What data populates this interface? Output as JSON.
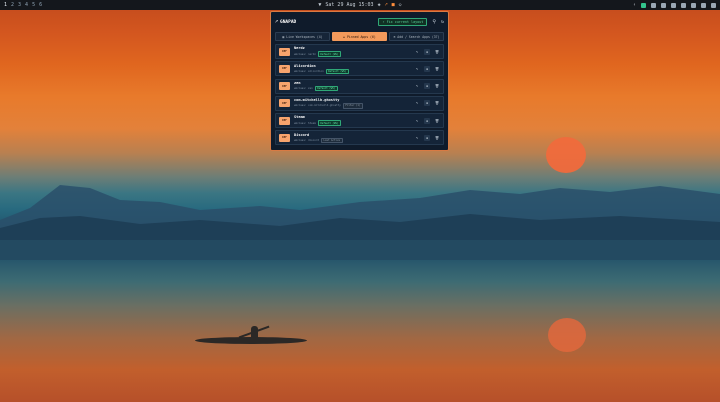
{
  "topbar": {
    "workspaces": [
      "1",
      "2",
      "3",
      "4",
      "5",
      "6"
    ],
    "clock": "Sat 29 Aug 15:03",
    "tray_icons": [
      "chevron-left-icon",
      "display-icon",
      "network-icon",
      "battery-icon",
      "volume-icon",
      "bluetooth-icon",
      "wifi-icon",
      "notifications-icon",
      "power-icon"
    ]
  },
  "dialog": {
    "title": "GNAPAD",
    "fix_button": "Fix current layout",
    "tabs": [
      {
        "label": "Live Workspaces (4)"
      },
      {
        "label": "Pinned Apps (6)"
      },
      {
        "label": "Add / Search Apps (37)"
      }
    ],
    "apps": [
      {
        "name": "Nerdz",
        "meta": "wmclass: nerdz",
        "badge": "Default (WS)",
        "badge_style": "green"
      },
      {
        "name": "Alicordion",
        "meta": "wmclass: alicordion",
        "badge": "Default (WS)",
        "badge_style": "green"
      },
      {
        "name": "zen",
        "meta": "wmclass: zen",
        "badge": "Default (WS)",
        "badge_style": "green"
      },
      {
        "name": "com.mitchellh.ghostty",
        "meta": "wmclass: com.mitchellh.ghostty",
        "badge": "Filter (1)",
        "badge_style": "gray"
      },
      {
        "name": "Steam",
        "meta": "wmclass: Steam",
        "badge": "Default (WS)",
        "badge_style": "green"
      },
      {
        "name": "Discord",
        "meta": "wmclass: discord",
        "badge": "Last Active",
        "badge_style": "gray"
      }
    ],
    "icon_label": "DEF"
  },
  "colors": {
    "accent": "#f39a5b",
    "green": "#2fa877",
    "panel": "#0f1b2b"
  }
}
